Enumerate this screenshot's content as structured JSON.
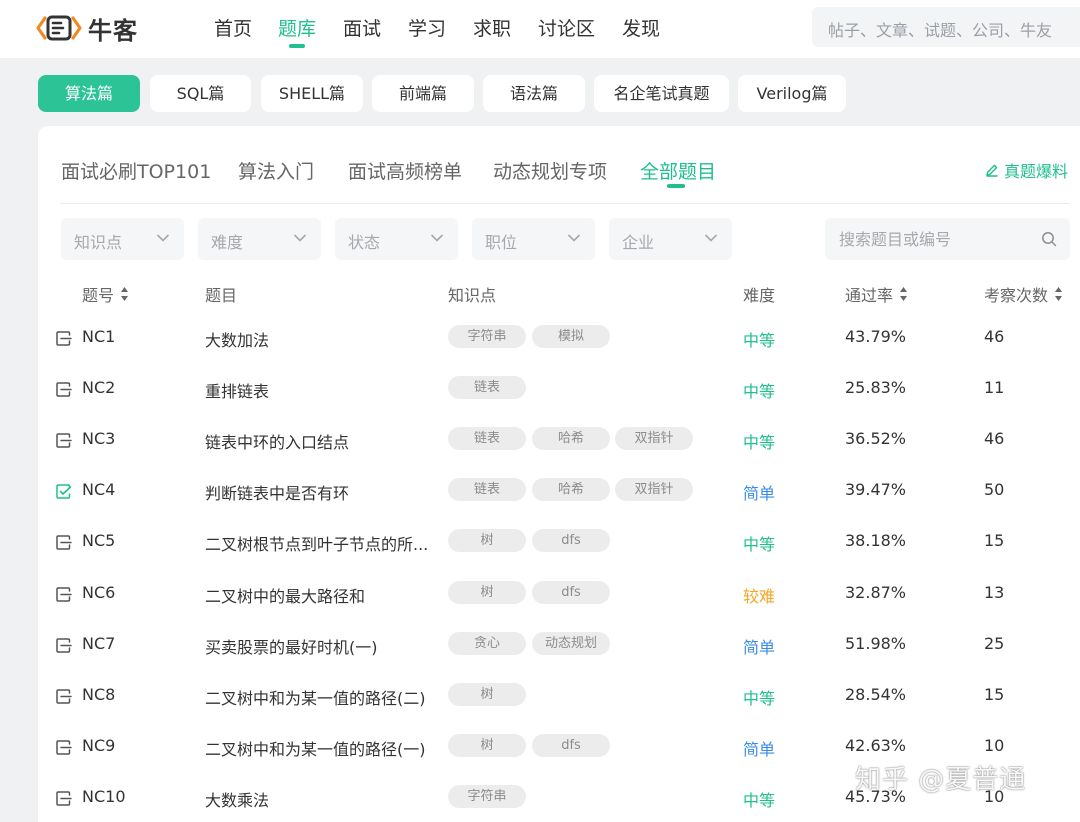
{
  "brand": {
    "logo_text": "牛客",
    "accent_color": "#1fbf8f"
  },
  "nav": {
    "items": [
      {
        "label": "首页"
      },
      {
        "label": "题库"
      },
      {
        "label": "面试"
      },
      {
        "label": "学习"
      },
      {
        "label": "求职"
      },
      {
        "label": "讨论区"
      },
      {
        "label": "发现"
      }
    ],
    "active_index": 1,
    "search_placeholder": "帖子、文章、试题、公司、牛友"
  },
  "categories": {
    "items": [
      {
        "label": "算法篇"
      },
      {
        "label": "SQL篇"
      },
      {
        "label": "SHELL篇"
      },
      {
        "label": "前端篇"
      },
      {
        "label": "语法篇"
      },
      {
        "label": "名企笔试真题"
      },
      {
        "label": "Verilog篇"
      }
    ],
    "active_index": 0
  },
  "subtabs": {
    "items": [
      {
        "label": "面试必刷TOP101"
      },
      {
        "label": "算法入门"
      },
      {
        "label": "面试高频榜单"
      },
      {
        "label": "动态规划专项"
      },
      {
        "label": "全部题目"
      }
    ],
    "active_index": 4,
    "leak_link": "真题爆料",
    "leak_icon": "pencil-icon"
  },
  "filters": {
    "items": [
      {
        "label": "知识点"
      },
      {
        "label": "难度"
      },
      {
        "label": "状态"
      },
      {
        "label": "职位"
      },
      {
        "label": "企业"
      }
    ],
    "search_placeholder": "搜索题目或编号"
  },
  "table": {
    "headers": {
      "id": "题号",
      "title": "题目",
      "tags": "知识点",
      "difficulty": "难度",
      "pass_rate": "通过率",
      "count": "考察次数"
    },
    "difficulty_colors": {
      "中等": "#1fbf8f",
      "简单": "#3a8ee6",
      "较难": "#f5a623"
    },
    "rows": [
      {
        "id": "NC1",
        "title": "大数加法",
        "tags": [
          "字符串",
          "模拟"
        ],
        "difficulty": "中等",
        "pass_rate": "43.79%",
        "count": "46",
        "solved": false
      },
      {
        "id": "NC2",
        "title": "重排链表",
        "tags": [
          "链表"
        ],
        "difficulty": "中等",
        "pass_rate": "25.83%",
        "count": "11",
        "solved": false
      },
      {
        "id": "NC3",
        "title": "链表中环的入口结点",
        "tags": [
          "链表",
          "哈希",
          "双指针"
        ],
        "difficulty": "中等",
        "pass_rate": "36.52%",
        "count": "46",
        "solved": false
      },
      {
        "id": "NC4",
        "title": "判断链表中是否有环",
        "tags": [
          "链表",
          "哈希",
          "双指针"
        ],
        "difficulty": "简单",
        "pass_rate": "39.47%",
        "count": "50",
        "solved": true
      },
      {
        "id": "NC5",
        "title": "二叉树根节点到叶子节点的所...",
        "tags": [
          "树",
          "dfs"
        ],
        "difficulty": "中等",
        "pass_rate": "38.18%",
        "count": "15",
        "solved": false
      },
      {
        "id": "NC6",
        "title": "二叉树中的最大路径和",
        "tags": [
          "树",
          "dfs"
        ],
        "difficulty": "较难",
        "pass_rate": "32.87%",
        "count": "13",
        "solved": false
      },
      {
        "id": "NC7",
        "title": "买卖股票的最好时机(一)",
        "tags": [
          "贪心",
          "动态规划"
        ],
        "difficulty": "简单",
        "pass_rate": "51.98%",
        "count": "25",
        "solved": false
      },
      {
        "id": "NC8",
        "title": "二叉树中和为某一值的路径(二)",
        "tags": [
          "树"
        ],
        "difficulty": "中等",
        "pass_rate": "28.54%",
        "count": "15",
        "solved": false
      },
      {
        "id": "NC9",
        "title": "二叉树中和为某一值的路径(一)",
        "tags": [
          "树",
          "dfs"
        ],
        "difficulty": "简单",
        "pass_rate": "42.63%",
        "count": "10",
        "solved": false
      },
      {
        "id": "NC10",
        "title": "大数乘法",
        "tags": [
          "字符串"
        ],
        "difficulty": "中等",
        "pass_rate": "45.73%",
        "count": "10",
        "solved": false
      }
    ]
  },
  "watermark": "知乎 @夏普通"
}
